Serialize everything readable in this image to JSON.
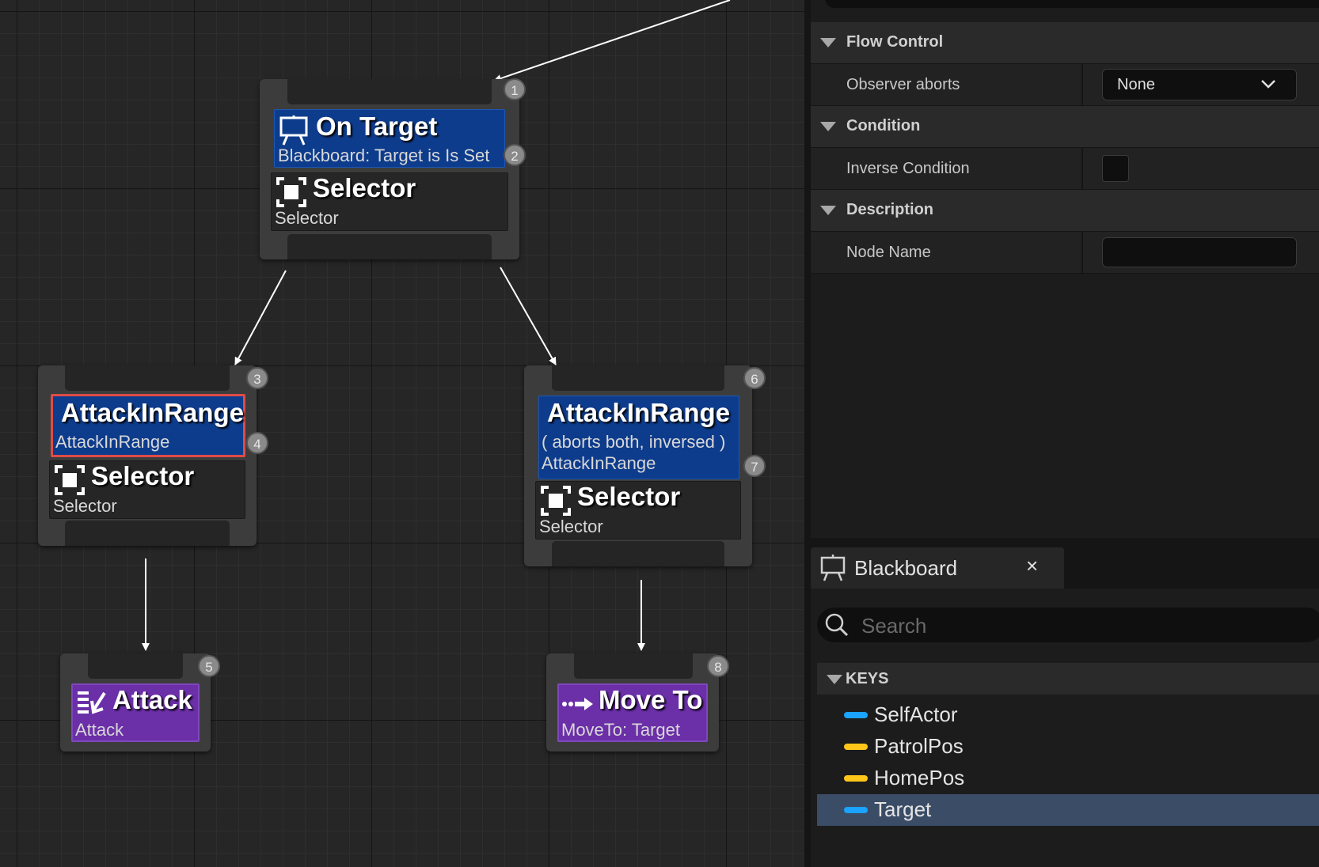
{
  "graph": {
    "root": {
      "badge": "1",
      "decorator": {
        "title": "On Target",
        "subtitle": "Blackboard: Target is Is Set",
        "badge": "2",
        "icon": "blackboard-icon"
      },
      "composite": {
        "title": "Selector",
        "subtitle": "Selector",
        "icon": "selector-icon"
      }
    },
    "left": {
      "badge": "3",
      "decorator": {
        "title": "AttackInRange",
        "subtitle": "AttackInRange",
        "badge": "4"
      },
      "composite": {
        "title": "Selector",
        "subtitle": "Selector",
        "icon": "selector-icon"
      }
    },
    "right": {
      "badge": "6",
      "decorator": {
        "title": "AttackInRange",
        "line1": "( aborts both, inversed )",
        "line2": "AttackInRange",
        "badge": "7"
      },
      "composite": {
        "title": "Selector",
        "subtitle": "Selector",
        "icon": "selector-icon"
      }
    },
    "attack": {
      "badge": "5",
      "title": "Attack",
      "subtitle": "Attack",
      "icon": "attack-task-icon"
    },
    "moveto": {
      "badge": "8",
      "title": "Move To",
      "subtitle": "MoveTo: Target",
      "icon": "move-to-icon"
    }
  },
  "details": {
    "flow_control": {
      "label": "Flow Control",
      "observer_aborts_label": "Observer aborts",
      "observer_aborts_value": "None"
    },
    "condition": {
      "label": "Condition",
      "inverse_condition_label": "Inverse Condition",
      "inverse_condition_checked": false
    },
    "description": {
      "label": "Description",
      "node_name_label": "Node Name",
      "node_name_value": ""
    }
  },
  "blackboard": {
    "tab_label": "Blackboard",
    "close_glyph": "×",
    "search_placeholder": "Search",
    "keys_header": "KEYS",
    "keys": [
      {
        "name": "SelfActor",
        "color": "#1aa3ff"
      },
      {
        "name": "PatrolPos",
        "color": "#ffc61a"
      },
      {
        "name": "HomePos",
        "color": "#ffc61a"
      },
      {
        "name": "Target",
        "color": "#1aa3ff",
        "selected": true
      }
    ]
  },
  "colors": {
    "decorator": "#0e3c8c",
    "task": "#6b2fa8",
    "selection_outline": "#e04b47"
  }
}
